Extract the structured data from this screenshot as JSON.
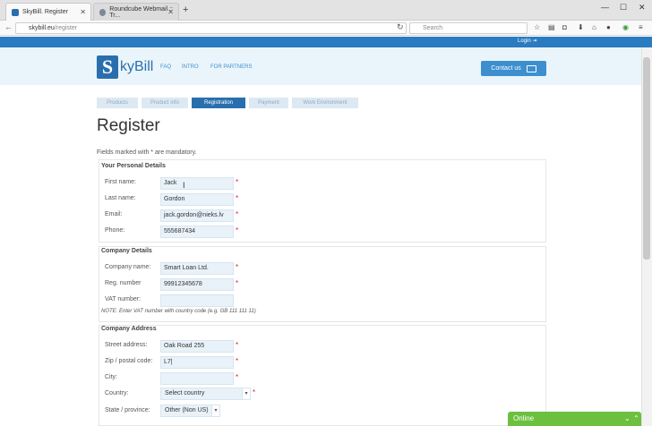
{
  "browser": {
    "tabs": [
      {
        "title": "SkyBill. Register"
      },
      {
        "title": "Roundcube Webmail :: Tr..."
      }
    ],
    "url_host": "skybill.eu",
    "url_path": "/register",
    "search_placeholder": "Search"
  },
  "site": {
    "login_label": "Login",
    "logo_letter": "S",
    "logo_rest": "kyBill",
    "menu": [
      "FAQ",
      "INTRO",
      "FOR PARTNERS"
    ],
    "contact_label": "Contact us",
    "steps": [
      {
        "label": "Products",
        "active": false
      },
      {
        "label": "Product info",
        "active": false
      },
      {
        "label": "Registration",
        "active": true
      },
      {
        "label": "Payment",
        "active": false
      },
      {
        "label": "Work Environment",
        "active": false
      }
    ],
    "page_title": "Register",
    "mandatory_note": "Fields marked with * are mandatory."
  },
  "personal": {
    "title": "Your Personal Details",
    "first_name_label": "First name:",
    "first_name_value": "Jack",
    "last_name_label": "Last name:",
    "last_name_value": "Gordon",
    "email_label": "Email:",
    "email_value": "jack.gordon@nieks.lv",
    "phone_label": "Phone:",
    "phone_value": "555687434"
  },
  "company": {
    "title": "Company Details",
    "name_label": "Company name:",
    "name_value": "Smart Loan Ltd.",
    "reg_label": "Reg. number",
    "reg_value": "99912345678",
    "vat_label": "VAT number:",
    "vat_value": "",
    "vat_note": "NOTE: Enter VAT number with country code (e.g. GB 111 111 11)"
  },
  "address": {
    "title": "Company Address",
    "street_label": "Street address:",
    "street_value": "Oak Road 255",
    "zip_label": "Zip / postal code:",
    "zip_value": "L7",
    "city_label": "City:",
    "city_value": "",
    "country_label": "Country:",
    "country_value": "Select country",
    "state_label": "State / province:",
    "state_value": "Other (Non US)"
  },
  "chat": {
    "label": "Online"
  },
  "required_mark": "*"
}
